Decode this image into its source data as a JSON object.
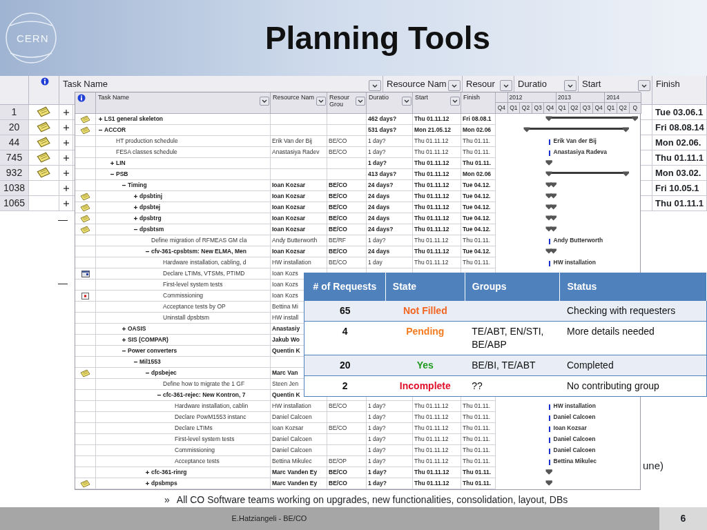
{
  "slide": {
    "logo_text": "CERN",
    "title": "Planning Tools"
  },
  "outer_view": {
    "header": [
      {
        "label": "Task Name",
        "filter": true
      },
      {
        "label": "Resource Nam",
        "filter": true
      },
      {
        "label": "Resour",
        "filter": true
      },
      {
        "label": "Duratio",
        "filter": true
      },
      {
        "label": "Start",
        "filter": true
      },
      {
        "label": "Finish",
        "filter": false
      }
    ],
    "rows": [
      {
        "id": "1",
        "indicator": {
          "kind": "note"
        },
        "expanded": false,
        "finish": "Tue 03.06.1"
      },
      {
        "id": "20",
        "indicator": {
          "kind": "note"
        },
        "expanded": false,
        "finish": "Fri 08.08.14"
      },
      {
        "id": "44",
        "indicator": {
          "kind": "note"
        },
        "expanded": false,
        "finish": "Mon 02.06."
      },
      {
        "id": "745",
        "indicator": {
          "kind": "note"
        },
        "expanded": false,
        "finish": "Thu 01.11.1"
      },
      {
        "id": "932",
        "indicator": {
          "kind": "note"
        },
        "expanded": false,
        "finish": "Mon 03.02."
      },
      {
        "id": "1038",
        "expanded": false,
        "finish": "Fri 10.05.1"
      },
      {
        "id": "1065",
        "expanded": false,
        "finish": "Thu 01.11.1"
      }
    ]
  },
  "inner_view": {
    "columns": [
      {
        "label": "Task Name",
        "filter": true
      },
      {
        "label": "Resource Nam",
        "filter": true
      },
      {
        "label": "Resour Grou",
        "filter": true
      },
      {
        "label": "Duratio",
        "filter": true
      },
      {
        "label": "Start",
        "filter": true
      },
      {
        "label": "Finish",
        "filter": false
      }
    ],
    "gantt": {
      "years": [
        "2012",
        "2013",
        "2014"
      ],
      "quarters": [
        "Q4",
        "Q1",
        "Q2",
        "Q3",
        "Q4",
        "Q1",
        "Q2",
        "Q3",
        "Q4",
        "Q1",
        "Q2",
        "Q"
      ]
    },
    "tasks": [
      {
        "name": "LS1 general skeleton",
        "kind": "summary",
        "expanded": false,
        "indicator": {
          "kind": "note"
        },
        "duration": "462 days?",
        "start": "Thu 01.11.12",
        "finish": "Fri 08.08.1"
      },
      {
        "name": "ACCOR",
        "kind": "summary",
        "expanded": true,
        "indicator": {
          "kind": "note"
        },
        "duration": "531 days?",
        "start": "Mon 21.05.12",
        "finish": "Mon 02.06",
        "children": [
          {
            "name": "HT production schedule",
            "kind": "task",
            "resource": "Erik Van der Bij",
            "group": "BE/CO",
            "duration": "1 day?",
            "start": "Thu 01.11.12",
            "finish": "Thu 01.11.",
            "gantt_label": "Erik Van der Bij"
          },
          {
            "name": "FESA classes schedule",
            "kind": "task",
            "resource": "Anastasiya Radev",
            "group": "BE/CO",
            "duration": "1 day?",
            "start": "Thu 01.11.12",
            "finish": "Thu 01.11.",
            "gantt_label": "Anastasiya Radeva"
          },
          {
            "name": "LIN",
            "kind": "summary",
            "expanded": false,
            "duration": "1 day?",
            "start": "Thu 01.11.12",
            "finish": "Thu 01.11."
          },
          {
            "name": "PSB",
            "kind": "summary",
            "expanded": true,
            "duration": "413 days?",
            "start": "Thu 01.11.12",
            "finish": "Mon 02.06",
            "children": [
              {
                "name": "Timing",
                "kind": "summary",
                "expanded": true,
                "resource": "Ioan Kozsar",
                "group": "BE/CO",
                "duration": "24 days?",
                "start": "Thu 01.11.12",
                "finish": "Tue 04.12.",
                "children": [
                  {
                    "name": "dpsbtinj",
                    "kind": "summary",
                    "expanded": false,
                    "indicator": {
                      "kind": "note"
                    },
                    "resource": "Ioan Kozsar",
                    "group": "BE/CO",
                    "duration": "24 days",
                    "start": "Thu 01.11.12",
                    "finish": "Tue 04.12."
                  },
                  {
                    "name": "dpsbtej",
                    "kind": "summary",
                    "expanded": false,
                    "indicator": {
                      "kind": "note"
                    },
                    "resource": "Ioan Kozsar",
                    "group": "BE/CO",
                    "duration": "24 days",
                    "start": "Thu 01.11.12",
                    "finish": "Tue 04.12."
                  },
                  {
                    "name": "dpsbtrg",
                    "kind": "summary",
                    "expanded": false,
                    "indicator": {
                      "kind": "note"
                    },
                    "resource": "Ioan Kozsar",
                    "group": "BE/CO",
                    "duration": "24 days",
                    "start": "Thu 01.11.12",
                    "finish": "Tue 04.12."
                  },
                  {
                    "name": "dpsbtsm",
                    "kind": "summary",
                    "expanded": true,
                    "indicator": {
                      "kind": "note"
                    },
                    "resource": "Ioan Kozsar",
                    "group": "BE/CO",
                    "duration": "24 days?",
                    "start": "Thu 01.11.12",
                    "finish": "Tue 04.12.",
                    "children": [
                      {
                        "name": "Define migration of RFMEAS GM cla",
                        "kind": "task",
                        "resource": "Andy Butterworth",
                        "group": "BE/RF",
                        "duration": "1 day?",
                        "start": "Thu 01.11.12",
                        "finish": "Thu 01.11.",
                        "gantt_label": "Andy Butterworth"
                      },
                      {
                        "name": "cfv-361-cpsbtsm: New ELMA, Men",
                        "kind": "summary",
                        "expanded": true,
                        "resource": "Ioan Kozsar",
                        "group": "BE/CO",
                        "duration": "24 days",
                        "start": "Thu 01.11.12",
                        "finish": "Tue 04.12.",
                        "children": [
                          {
                            "name": "Hardware installation, cabling, d",
                            "kind": "task",
                            "resource": "HW installation",
                            "group": "BE/CO",
                            "duration": "1 day",
                            "start": "Thu 01.11.12",
                            "finish": "Thu 01.11.",
                            "gantt_label": "HW installation"
                          },
                          {
                            "name": "Declare LTIMs, VTSMs, PTIMD",
                            "kind": "task",
                            "indicator": {
                              "kind": "calendar"
                            },
                            "resource": "Ioan Kozs"
                          },
                          {
                            "name": "First-level system tests",
                            "kind": "task",
                            "resource": "Ioan Kozs"
                          },
                          {
                            "name": "Commissioning",
                            "kind": "task",
                            "indicator": {
                              "kind": "constraint"
                            },
                            "resource": "Ioan Kozs"
                          },
                          {
                            "name": "Acceptance tests by OP",
                            "kind": "task",
                            "resource": "Bettina Mi"
                          },
                          {
                            "name": "Uninstall dpsbtsm",
                            "kind": "task",
                            "resource": "HW install"
                          }
                        ]
                      }
                    ]
                  }
                ]
              },
              {
                "name": "OASIS",
                "kind": "summary",
                "expanded": false,
                "resource": "Anastasiy"
              },
              {
                "name": "SIS (COMPAR)",
                "kind": "summary",
                "expanded": false,
                "resource": "Jakub Wo"
              },
              {
                "name": "Power converters",
                "kind": "summary",
                "expanded": true,
                "resource": "Quentin K",
                "children": [
                  {
                    "name": "Mil1553",
                    "kind": "summary",
                    "expanded": true,
                    "children": [
                      {
                        "name": "dpsbejec",
                        "kind": "summary",
                        "expanded": true,
                        "indicator": {
                          "kind": "note"
                        },
                        "resource": "Marc Van",
                        "children": [
                          {
                            "name": "Define how to migrate the 1 GF",
                            "kind": "task",
                            "resource": "Steen Jen"
                          },
                          {
                            "name": "cfc-361-rejec: New Kontron, 7",
                            "kind": "summary",
                            "expanded": true,
                            "resource": "Quentin K",
                            "children": [
                              {
                                "name": "Hardware installation, cablin",
                                "kind": "task",
                                "resource": "HW installation",
                                "group": "BE/CO",
                                "duration": "1 day?",
                                "start": "Thu 01.11.12",
                                "finish": "Thu 01.11.",
                                "gantt_label": "HW installation"
                              },
                              {
                                "name": "Declare PowM1553 instanc",
                                "kind": "task",
                                "resource": "Daniel Calcoen",
                                "duration": "1 day?",
                                "start": "Thu 01.11.12",
                                "finish": "Thu 01.11.",
                                "gantt_label": "Daniel Calcoen"
                              },
                              {
                                "name": "Declare LTIMs",
                                "kind": "task",
                                "resource": "Ioan Kozsar",
                                "group": "BE/CO",
                                "duration": "1 day?",
                                "start": "Thu 01.11.12",
                                "finish": "Thu 01.11.",
                                "gantt_label": "Ioan Kozsar"
                              },
                              {
                                "name": "First-level system tests",
                                "kind": "task",
                                "resource": "Daniel Calcoen",
                                "duration": "1 day?",
                                "start": "Thu 01.11.12",
                                "finish": "Thu 01.11.",
                                "gantt_label": "Daniel Calcoen"
                              },
                              {
                                "name": "Commissioning",
                                "kind": "task",
                                "resource": "Daniel Calcoen",
                                "duration": "1 day?",
                                "start": "Thu 01.11.12",
                                "finish": "Thu 01.11.",
                                "gantt_label": "Daniel Calcoen"
                              },
                              {
                                "name": "Acceptance tests",
                                "kind": "task",
                                "resource": "Bettina Mikulec",
                                "group": "BE/OP",
                                "duration": "1 day?",
                                "start": "Thu 01.11.12",
                                "finish": "Thu 01.11.",
                                "gantt_label": "Bettina Mikulec"
                              }
                            ]
                          }
                        ]
                      },
                      {
                        "name": "cfc-361-rinrg",
                        "kind": "summary",
                        "expanded": false,
                        "resource": "Marc Vanden Ey",
                        "group": "BE/CO",
                        "duration": "1 day?",
                        "start": "Thu 01.11.12",
                        "finish": "Thu 01.11."
                      },
                      {
                        "name": "dpsbmps",
                        "kind": "summary",
                        "expanded": false,
                        "indicator": {
                          "kind": "note"
                        },
                        "resource": "Marc Vanden Ey",
                        "group": "BE/CO",
                        "duration": "1 day?",
                        "start": "Thu 01.11.12",
                        "finish": "Thu 01.11."
                      }
                    ]
                  }
                ]
              }
            ]
          }
        ]
      }
    ]
  },
  "requests_table": {
    "columns": [
      "# of Requests",
      "State",
      "Groups",
      "Status"
    ],
    "rows": [
      {
        "count": "65",
        "state": "Not Filled",
        "color": "#f26522",
        "status": "Checking with requesters"
      },
      {
        "count": "4",
        "state": "Pending",
        "color": "#f47b20",
        "groups": "TE/ABT, EN/STI, BE/ABP",
        "status": "More details needed"
      },
      {
        "count": "20",
        "state": "Yes",
        "color": "#1f9a1f",
        "groups": "BE/BI, TE/ABT",
        "status": "Completed"
      },
      {
        "count": "2",
        "state": "Incomplete",
        "color": "#e0102a",
        "groups": "??",
        "status": "No contributing group"
      }
    ]
  },
  "slide_text": {
    "dashes": [
      "—",
      "—"
    ],
    "fragment": "une)",
    "bullet_marker": "»",
    "bullet": "All CO Software teams working on upgrades, new functionalities, consolidation, layout, DBs"
  },
  "footer": {
    "author": "E.Hatziangeli - BE/CO",
    "page": "6"
  }
}
